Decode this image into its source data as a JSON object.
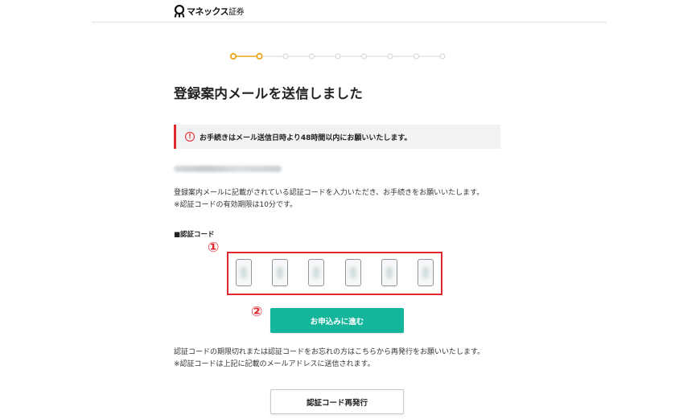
{
  "header": {
    "logo_text": "マネックス",
    "logo_sub": "証券"
  },
  "stepper": {
    "total_steps": 9,
    "completed_steps": 2,
    "active_color": "#e6a817",
    "inactive_color": "#c8c8c8"
  },
  "page": {
    "title": "登録案内メールを送信しました"
  },
  "alert": {
    "icon": "!",
    "text": "お手続きはメール送信日時より48時間以内にお願いいたします。",
    "accent_color": "#e0262f"
  },
  "email": {
    "value": "(blurred email address)"
  },
  "instructions": {
    "line1": "登録案内メールに記載がされている認証コードを入力いただき、お手続きをお願いいたします。",
    "line2": "※認証コードの有効期限は10分です。"
  },
  "code_section": {
    "label": "■認証コード",
    "marker": "①",
    "digits": [
      "",
      "",
      "",
      "",
      "",
      ""
    ]
  },
  "submit": {
    "marker": "②",
    "label": "お申込みに進む",
    "color": "#14b59a"
  },
  "resend_info": {
    "line1": "認証コードの期限切れまたは認証コードをお忘れの方はこちらから再発行をお願いいたします。",
    "line2": "※認証コードは上記に記載のメールアドレスに送信されます。"
  },
  "resend": {
    "label": "認証コード再発行"
  }
}
